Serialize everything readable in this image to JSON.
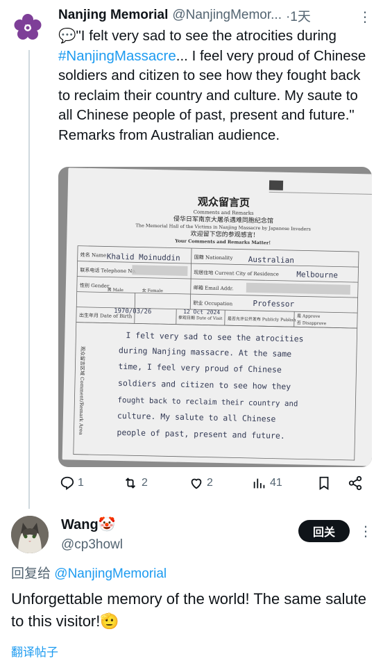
{
  "tweet1": {
    "name": "Nanjing Memorial",
    "handle": "@NanjingMemor...",
    "time": "·1天",
    "text_prefix": "💬\"I felt very sad to see the atrocities during ",
    "hashtag": "#NanjingMassacre",
    "text_suffix": "... I feel very proud of Chinese soldiers and citizen to see how they fought back to reclaim their country and culture. My saute to all Chinese people of past, present and future.\" Remarks from Australian audience.",
    "media": {
      "title_cn": "观众留言页",
      "title_en": "Comments and Remarks",
      "org_cn": "侵华日军南京大屠杀遇难同胞纪念馆",
      "org_en": "The Memorial Hall of the Victims in Nanjing Massacre by Japanese Invaders",
      "welcome_cn": "欢迎留下您的参观感言!",
      "welcome_en": "Your Comments and Remarks Matter!",
      "name_label": "姓名 Name",
      "name_value": "Khalid Moinuddin",
      "nationality_label": "国籍 Nationality",
      "nationality_value": "Australian",
      "city_label": "现居住地 Current City of Residence",
      "city_value": "Melbourne",
      "phone_label": "联系电话 Telephone No.",
      "email_label": "邮箱 Email Addr.",
      "gender_label": "性别 Gender",
      "male_label": "男 Male",
      "female_label": "女 Female",
      "occupation_label": "职业 Occupation",
      "occupation_value": "Professor",
      "dob_label": "出生年月 Date of Birth",
      "dob_value": "1970/03/26",
      "visit_label": "参观日期 Date of Visit",
      "visit_value": "12 Oct 2024",
      "publish_label": "是否允许公开发布 Publicly Publish",
      "approve_label": "是 Approve",
      "disapprove_label": "否 Disapprove",
      "comment_label": "观众留言区域 Comment/Remark Area",
      "handwriting": [
        "I felt very sad to see the atrocities",
        "during Nanjing massacre. At the same",
        "time, I feel very proud of Chinese",
        "soldiers and citizen to see how they",
        "fought back to reclaim their country and",
        "culture. My salute to all Chinese",
        "people of past, present and future."
      ]
    },
    "actions": {
      "replies": "1",
      "retweets": "2",
      "likes": "2",
      "views": "41"
    }
  },
  "tweet2": {
    "name": "Wang",
    "name_emoji": "🤡",
    "handle": "@cp3howl",
    "follow_label": "回关",
    "replying_prefix": "回复给",
    "replying_handle": "@NanjingMemorial",
    "text": "Unforgettable memory of the world! The same salute to this visitor!",
    "text_emoji": "🫡",
    "translate": "翻译帖子"
  },
  "colors": {
    "link": "#1d9bf0",
    "muted": "#536471",
    "text": "#0f1419",
    "avatar_purple": "#7e3f98"
  },
  "icons": [
    "more-icon",
    "reply-icon",
    "retweet-icon",
    "like-icon",
    "views-icon",
    "bookmark-icon",
    "share-icon"
  ]
}
